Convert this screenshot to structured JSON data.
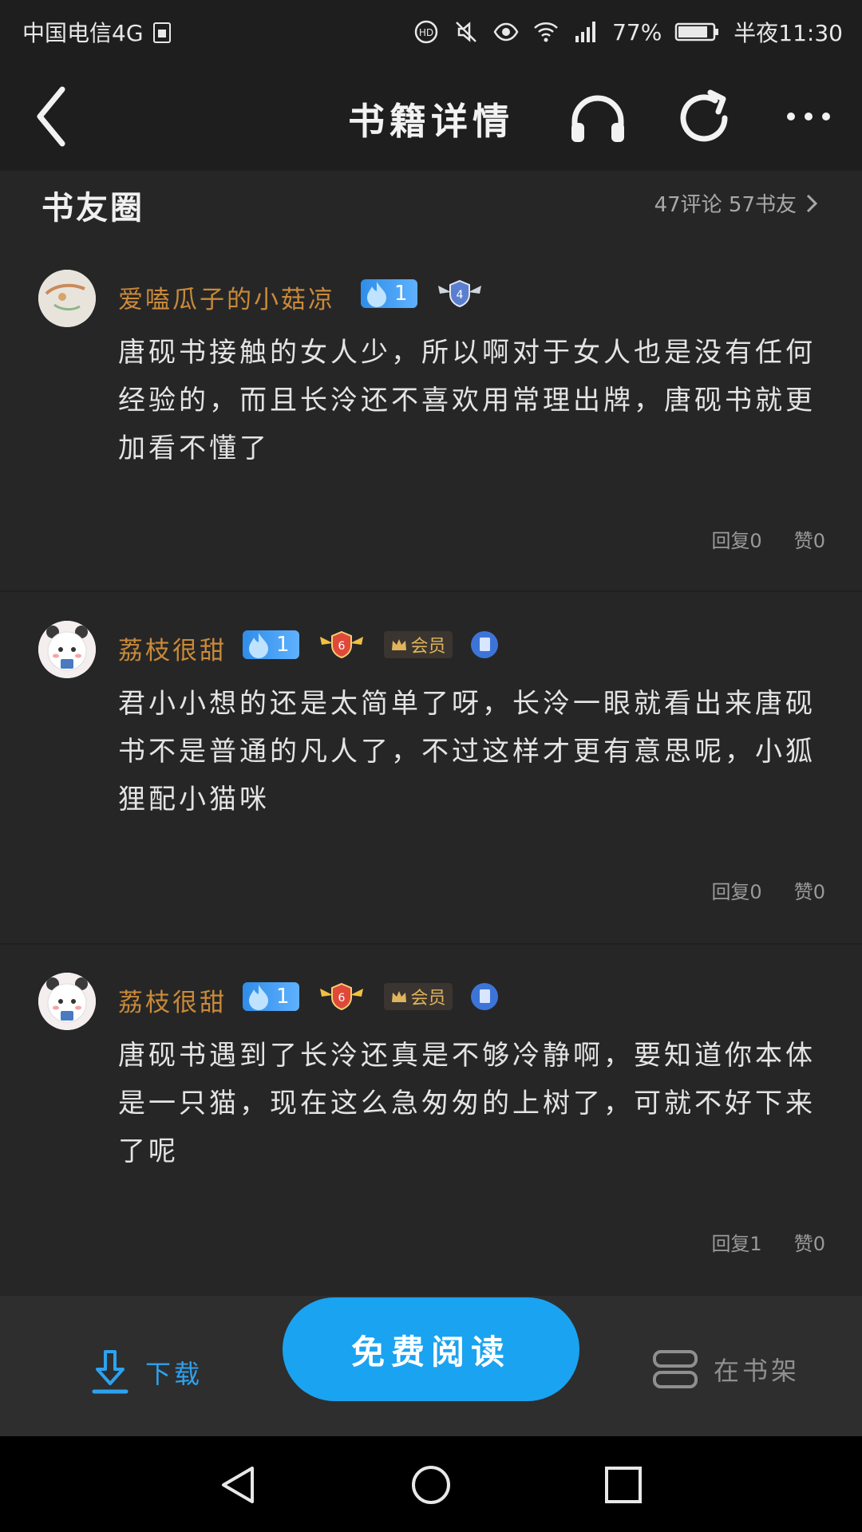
{
  "status_bar": {
    "carrier": "中国电信4G",
    "battery_pct": "77%",
    "time": "半夜11:30",
    "icons": [
      "sim-icon",
      "hd-call-icon",
      "mute-icon",
      "eye-icon",
      "wifi-icon",
      "signal-icon",
      "battery-icon"
    ]
  },
  "header": {
    "title": "书籍详情",
    "icons": [
      "back-icon",
      "headset-icon",
      "share-icon",
      "more-icon"
    ]
  },
  "section": {
    "title": "书友圈",
    "meta": "47评论 57书友"
  },
  "comments": [
    {
      "username": "爱嗑瓜子的小菇凉",
      "level": "1",
      "wing_level": "4",
      "vip": null,
      "text": "唐砚书接触的女人少，所以啊对于女人也是没有任何经验的，而且长泠还不喜欢用常理出牌，唐砚书就更加看不懂了",
      "reply_label": "回复0",
      "like_label": "赞0"
    },
    {
      "username": "荔枝很甜",
      "level": "1",
      "wing_level": "6",
      "vip": "会员",
      "text": "君小小想的还是太简单了呀，长泠一眼就看出来唐砚书不是普通的凡人了，不过这样才更有意思呢，小狐狸配小猫咪",
      "reply_label": "回复0",
      "like_label": "赞0"
    },
    {
      "username": "荔枝很甜",
      "level": "1",
      "wing_level": "6",
      "vip": "会员",
      "text": "唐砚书遇到了长泠还真是不够冷静啊，要知道你本体是一只猫，现在这么急匆匆的上树了，可就不好下来了呢",
      "reply_label": "回复1",
      "like_label": "赞0"
    }
  ],
  "actions": {
    "download": "下载",
    "read": "免费阅读",
    "shelf": "在书架"
  },
  "colors": {
    "accent": "#1aa3f0",
    "username": "#c98a3a",
    "background": "#262626"
  }
}
